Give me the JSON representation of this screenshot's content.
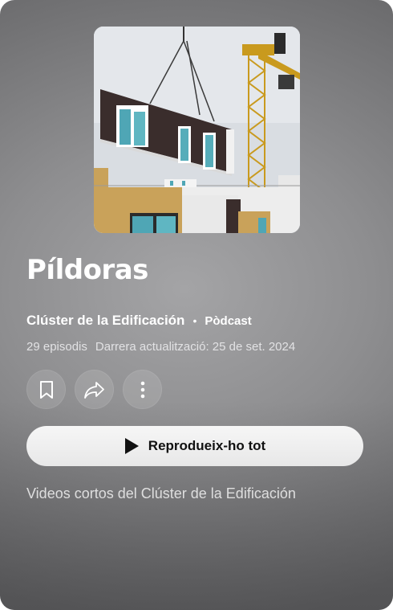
{
  "playlist": {
    "title": "Píldoras",
    "author": "Clúster de la Edificación",
    "separator": "•",
    "kind": "Pòdcast",
    "episodes": "29 episodis",
    "updated": "Darrera actualització: 25 de set. 2024",
    "description": "Videos cortos del Clúster de la Edificación"
  },
  "actions": {
    "save_icon": "bookmark-icon",
    "share_icon": "share-icon",
    "more_icon": "more-vert-icon",
    "play_icon": "play-icon",
    "play_label": "Reprodueix-ho tot"
  },
  "cover": {
    "subject": "crane lifting prefabricated facade module"
  },
  "colors": {
    "text": "#ffffff",
    "play_button_bg": "#ffffff",
    "play_button_text": "#0f0f0f"
  }
}
